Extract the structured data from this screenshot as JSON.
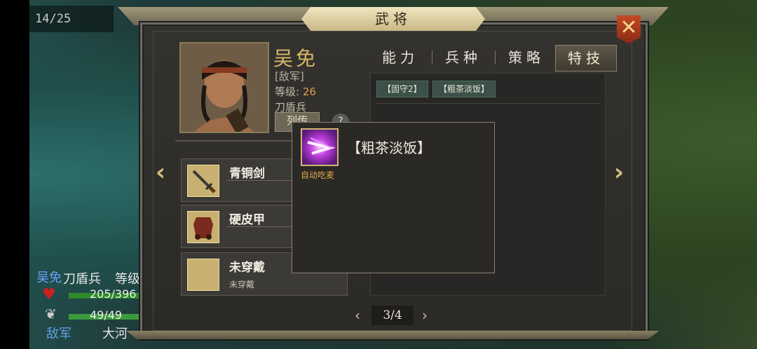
{
  "counter": "14/25",
  "title": "武将",
  "close_icon": "close-x-icon",
  "general": {
    "name": "吴免",
    "side": "[敌军]",
    "level_label": "等级:",
    "level_value": "26",
    "troop_type": "刀盾兵",
    "bio_button": "列传",
    "help": "?"
  },
  "tabs": [
    {
      "label": "能力",
      "active": false
    },
    {
      "label": "兵种",
      "active": false
    },
    {
      "label": "策略",
      "active": false
    },
    {
      "label": "特技",
      "active": true
    }
  ],
  "skill_chips": [
    "【固守2】",
    "【粗茶淡饭】"
  ],
  "equipment": [
    {
      "name": "青铜剑",
      "sub": "",
      "icon": "bronze-sword-icon"
    },
    {
      "name": "硬皮甲",
      "sub": "",
      "icon": "leather-armor-icon"
    },
    {
      "name": "未穿戴",
      "sub": "未穿戴",
      "icon": "empty-slot-icon"
    }
  ],
  "popup": {
    "title": "【粗茶淡饭】",
    "subtitle": "自动吃麦",
    "icon": "purple-skill-icon"
  },
  "pager": {
    "current": "3/4"
  },
  "background_unit": {
    "name": "吴免",
    "type": "刀盾兵",
    "level_label": "等级",
    "hp": "205/396",
    "sp": "49/49",
    "side": "敌军",
    "terrain": "大河"
  },
  "colors": {
    "accent_gold": "#d8b868",
    "panel_bg": "#2c2a27",
    "close_red": "#c44a24"
  }
}
